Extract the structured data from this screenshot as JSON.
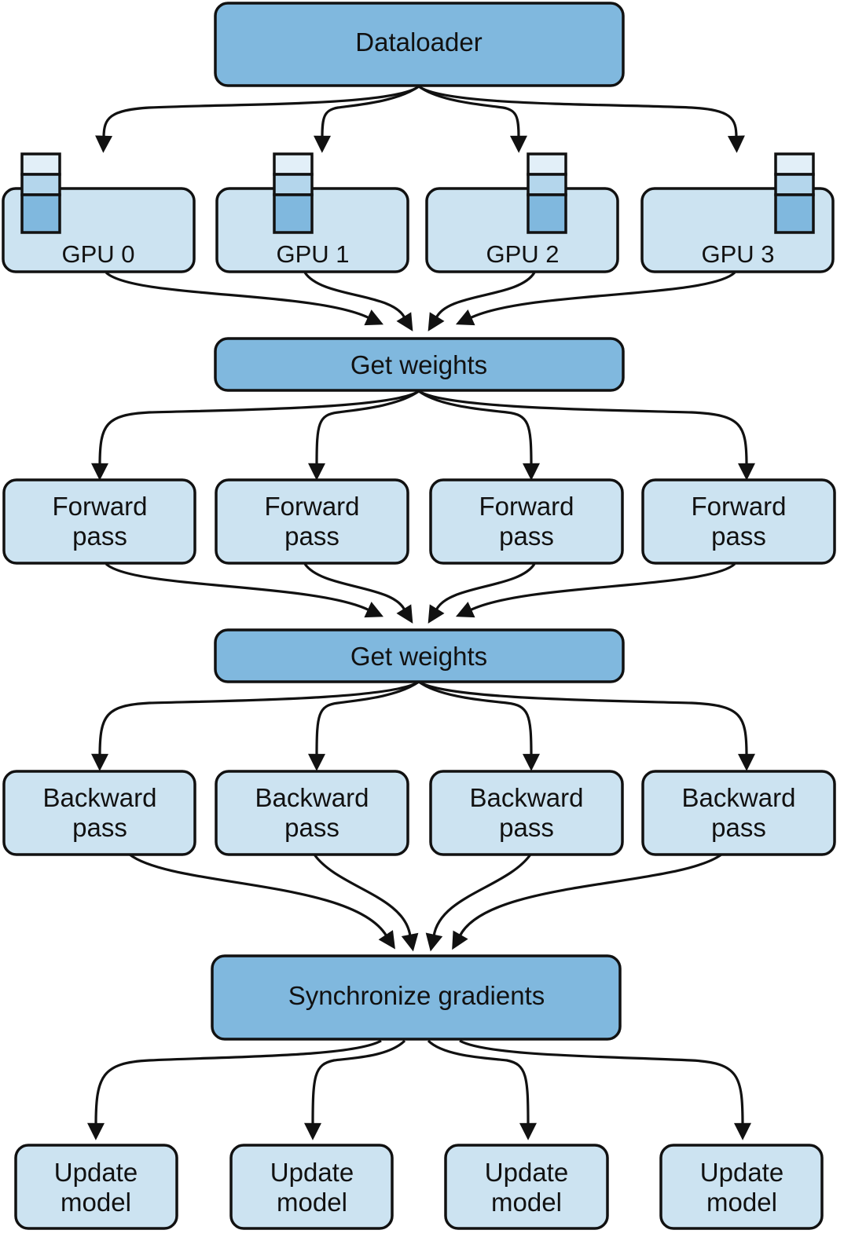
{
  "colors": {
    "dark_box": "#80b8de",
    "light_box": "#cce3f1",
    "stroke": "#111111",
    "batch_top": "#e2eff8",
    "batch_mid": "#b4d6ec",
    "batch_bottom": "#80b8de"
  },
  "dataloader": {
    "label": "Dataloader"
  },
  "gpus": [
    {
      "label": "GPU 0"
    },
    {
      "label": "GPU 1"
    },
    {
      "label": "GPU 2"
    },
    {
      "label": "GPU 3"
    }
  ],
  "get_weights_1": {
    "label": "Get weights"
  },
  "forward": [
    {
      "line1": "Forward",
      "line2": "pass"
    },
    {
      "line1": "Forward",
      "line2": "pass"
    },
    {
      "line1": "Forward",
      "line2": "pass"
    },
    {
      "line1": "Forward",
      "line2": "pass"
    }
  ],
  "get_weights_2": {
    "label": "Get weights"
  },
  "backward": [
    {
      "line1": "Backward",
      "line2": "pass"
    },
    {
      "line1": "Backward",
      "line2": "pass"
    },
    {
      "line1": "Backward",
      "line2": "pass"
    },
    {
      "line1": "Backward",
      "line2": "pass"
    }
  ],
  "sync": {
    "label": "Synchronize gradients"
  },
  "update": [
    {
      "line1": "Update",
      "line2": "model"
    },
    {
      "line1": "Update",
      "line2": "model"
    },
    {
      "line1": "Update",
      "line2": "model"
    },
    {
      "line1": "Update",
      "line2": "model"
    }
  ]
}
